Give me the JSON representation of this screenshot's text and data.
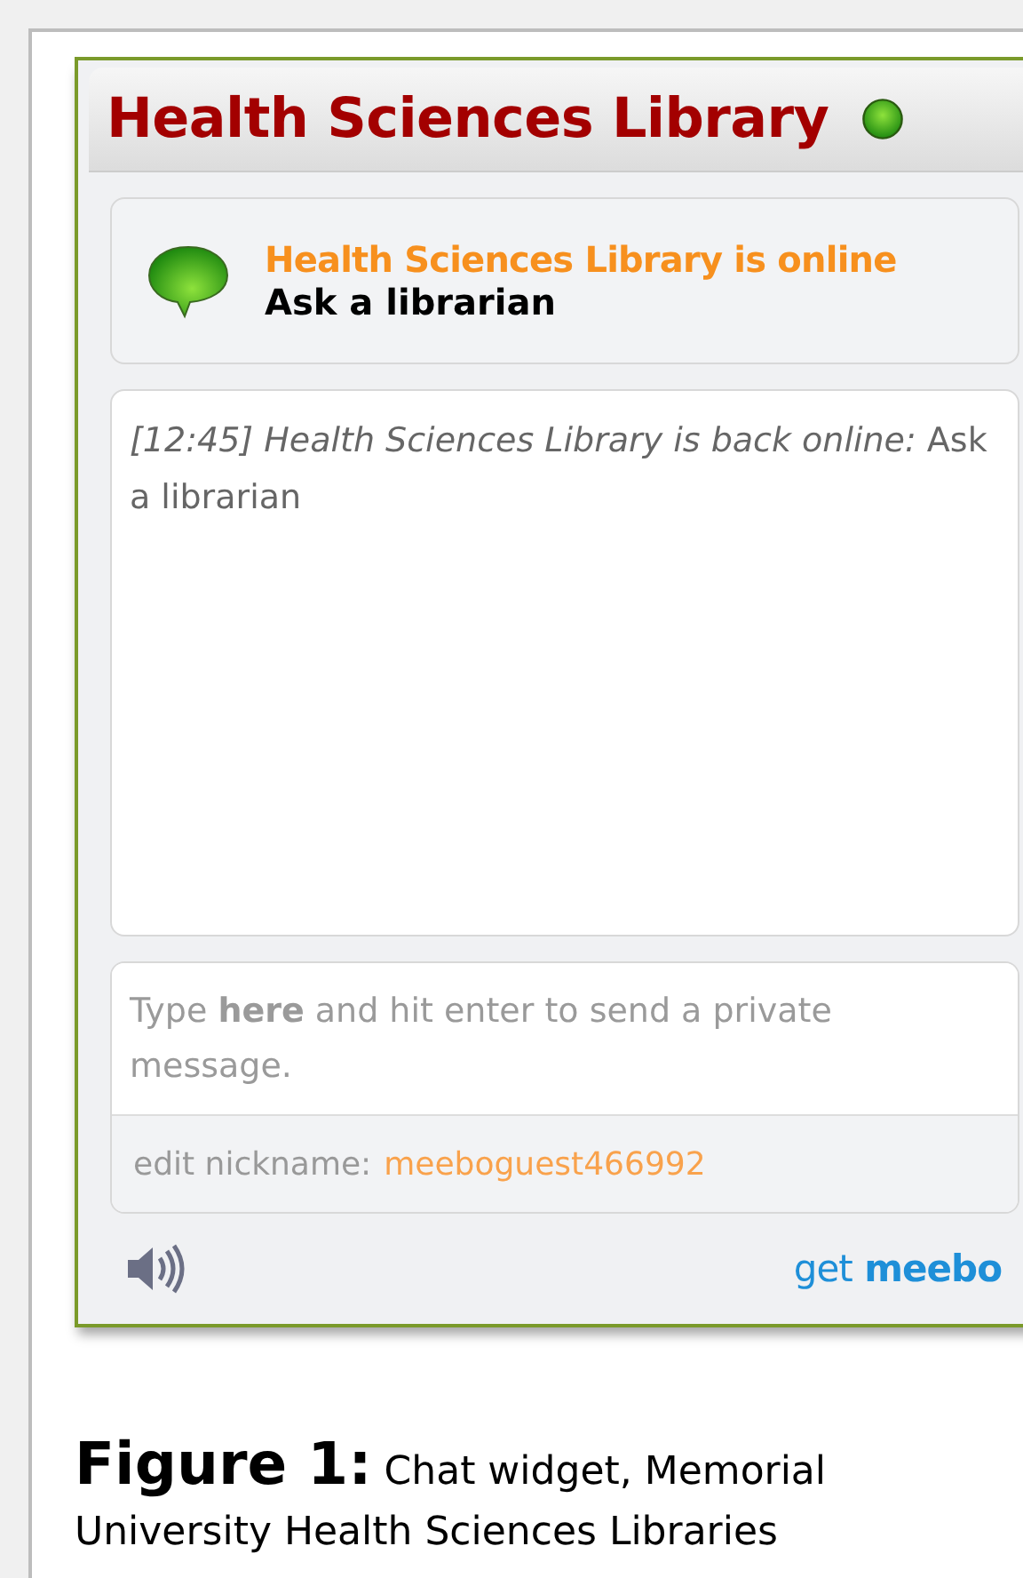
{
  "widget": {
    "title": "Health Sciences Library",
    "online": true
  },
  "status": {
    "label": "Health Sciences Library is online",
    "subtitle": "Ask a librarian"
  },
  "messages": [
    {
      "text": "*[12:45] Health Sciences Library is back online:* Ask a librarian"
    }
  ],
  "composer": {
    "placeholder": "Type **here** and hit enter to send a private message."
  },
  "nickname": {
    "label": "edit nickname:",
    "value": "meeboguest466992"
  },
  "footer": {
    "brand_prefix": "get",
    "brand_name": "meebo"
  },
  "caption": {
    "label": "Figure 1:",
    "text": "Chat widget, Memorial University Health Sciences Libraries"
  }
}
